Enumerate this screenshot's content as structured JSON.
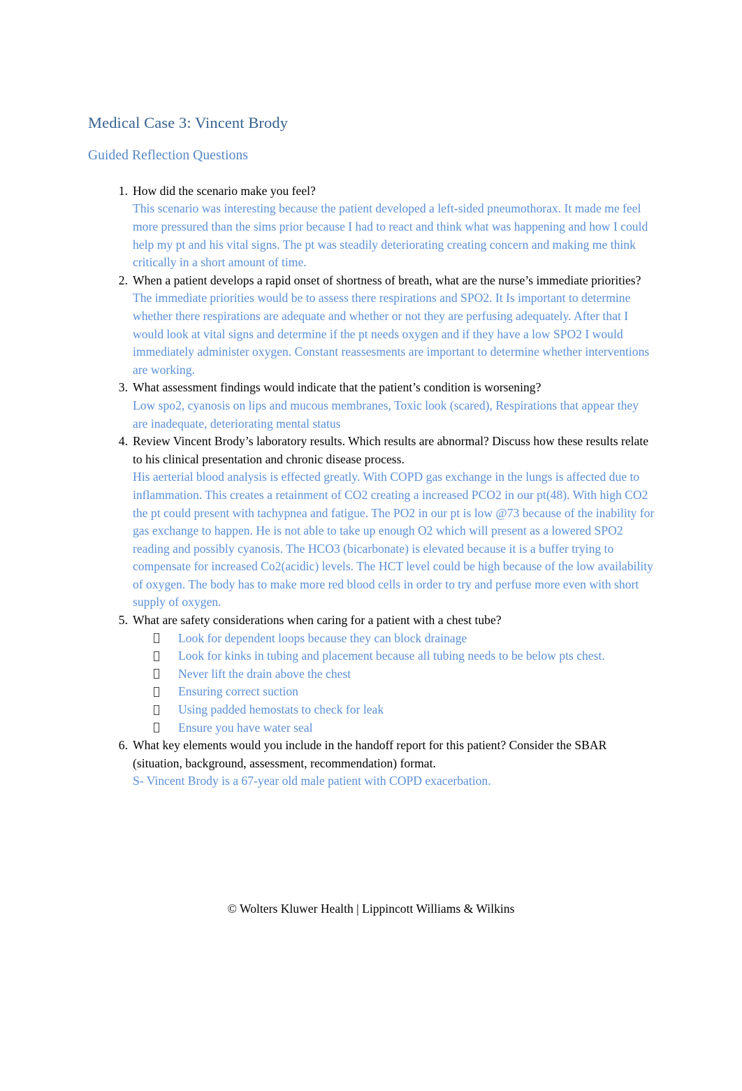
{
  "document": {
    "title": "Medical Case 3: Vincent Brody",
    "subtitle": "Guided Reflection Questions",
    "footer": "© Wolters Kluwer Health | Lippincott Williams & Wilkins",
    "colors": {
      "title": "#36618e",
      "subtitle": "#5586c4",
      "question_text": "#000000",
      "answer_text": "#5b8fd4",
      "bullet_glyph": "#3f3f3f",
      "page_background": "#ffffff"
    },
    "bullet_glyph_name": "missing-glyph-box"
  },
  "questions": [
    {
      "number": "1.",
      "question": "How did the scenario make you feel?",
      "answer": "This scenario was interesting because the patient developed a left-sided pneumothorax. It made me feel more pressured than the sims prior because I had to react and think what was happening and how I could help my pt and his vital signs. The pt was steadily deteriorating creating concern and making me think critically in a short amount of time."
    },
    {
      "number": "2.",
      "question": "When a patient develops a rapid onset of shortness of breath, what are the nurse’s immediate priorities?",
      "answer": "The immediate priorities would be to assess there respirations and SPO2. It Is important to determine whether there respirations are adequate and whether or not they are perfusing adequately. After that I would look at vital signs and determine if the pt needs oxygen and if they have a low SPO2 I would immediately administer oxygen. Constant reassesments are important to determine whether interventions are working."
    },
    {
      "number": "3.",
      "question": "What assessment findings would indicate that the patient’s condition is worsening?",
      "answer": "Low spo2, cyanosis on lips and mucous membranes, Toxic look (scared), Respirations that appear they are inadequate, deteriorating mental status"
    },
    {
      "number": "4.",
      "question": "Review Vincent Brody’s laboratory results. Which results are abnormal? Discuss how these results relate to his clinical presentation and chronic disease process.",
      "answer": "His aerterial blood analysis is effected greatly. With COPD gas exchange in the lungs is affected due to inflammation. This creates a retainment of CO2 creating a increased PCO2 in our pt(48). With high CO2 the pt could present with tachypnea and fatigue.   The PO2 in our pt is low @73 because of the inability for gas exchange to happen. He is not able to take up enough O2 which will present as a lowered SPO2 reading and possibly cyanosis. The HCO3 (bicarbonate) is elevated because it is a buffer trying to compensate for increased Co2(acidic) levels. The HCT level could be high because of the low availability of oxygen. The body has to make more red blood cells in order to try and perfuse more even with short supply of oxygen."
    },
    {
      "number": "5.",
      "question": "What are safety considerations when caring for a patient with a chest tube?",
      "bullets": [
        "Look for dependent loops because they can block drainage",
        "Look for kinks in tubing and placement because all tubing needs to be below pts chest.",
        "Never lift the drain above the chest",
        "Ensuring correct suction",
        "Using padded hemostats to check for leak",
        "Ensure you have water seal"
      ]
    },
    {
      "number": "6.",
      "question": "What key elements would you include in the handoff report for this patient? Consider the SBAR (situation, background, assessment, recommendation) format.",
      "answer": "S- Vincent Brody is a 67-year old male patient with COPD exacerbation."
    }
  ]
}
